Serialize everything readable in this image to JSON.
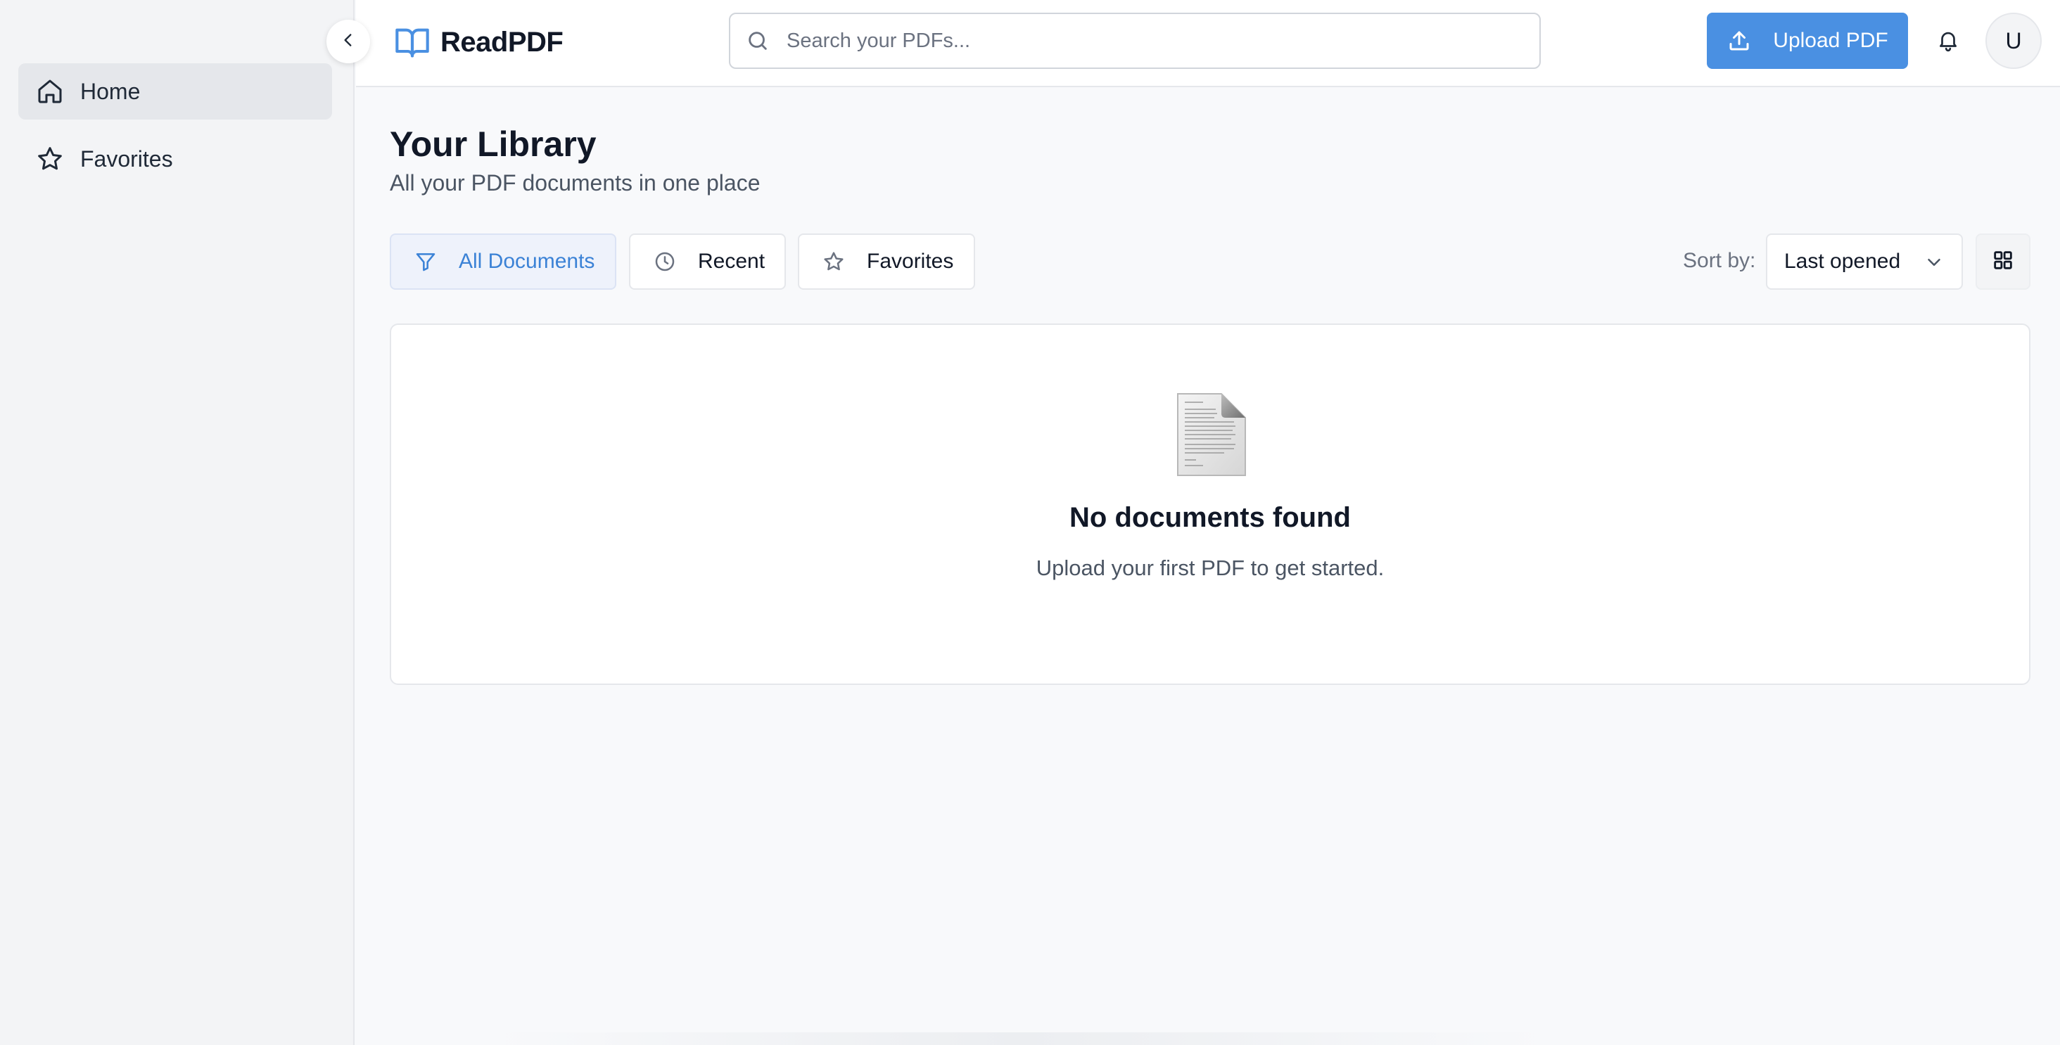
{
  "sidebar": {
    "items": [
      {
        "label": "Home",
        "icon": "home-icon",
        "active": true
      },
      {
        "label": "Favorites",
        "icon": "star-icon",
        "active": false
      }
    ],
    "collapse_icon": "chevron-left-icon"
  },
  "header": {
    "app_name": "ReadPDF",
    "logo_icon": "book-open-icon",
    "search_placeholder": "Search your PDFs...",
    "search_value": "",
    "upload_label": "Upload PDF",
    "notification_icon": "bell-icon",
    "avatar_initial": "U"
  },
  "main": {
    "title": "Your Library",
    "subtitle": "All your PDF documents in one place",
    "filters": [
      {
        "label": "All Documents",
        "icon": "filter-icon",
        "active": true
      },
      {
        "label": "Recent",
        "icon": "clock-icon",
        "active": false
      },
      {
        "label": "Favorites",
        "icon": "star-icon",
        "active": false
      }
    ],
    "sort_label": "Sort by:",
    "sort_value": "Last opened",
    "view_icon": "grid-icon",
    "empty_state": {
      "icon": "document-icon",
      "title": "No documents found",
      "message": "Upload your first PDF to get started."
    }
  },
  "colors": {
    "accent": "#4a90e2",
    "active_filter_text": "#3b82d6",
    "active_filter_bg": "#eef2fb",
    "sidebar_bg": "#f3f4f6",
    "page_bg": "#f8f9fb"
  }
}
